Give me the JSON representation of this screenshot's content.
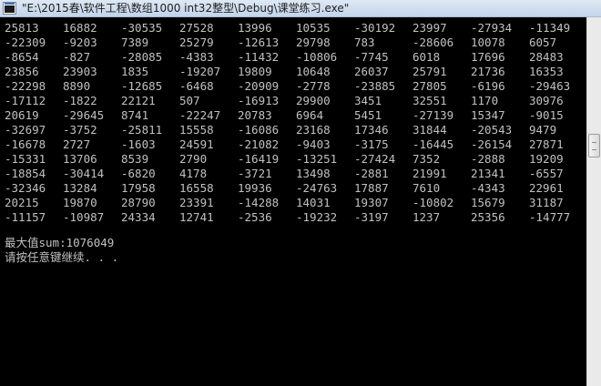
{
  "window": {
    "title": "\"E:\\2015春\\软件工程\\数组1000  int32整型\\Debug\\课堂练习.exe\"",
    "icon": "console-app-icon"
  },
  "console": {
    "rows": [
      [
        "25813",
        "16882",
        "-30535",
        "27528",
        "13996",
        "10535",
        "-30192",
        "23997",
        "-27934",
        "-11349"
      ],
      [
        "-22309",
        "-9203",
        "7389",
        "25279",
        "-12613",
        "29798",
        "783",
        "-28606",
        "10078",
        "6057"
      ],
      [
        "-8654",
        "-827",
        "-28085",
        "-4383",
        "-11432",
        "-10806",
        "-7745",
        "6018",
        "17696",
        "28483"
      ],
      [
        "23856",
        "23903",
        "1835",
        "-19207",
        "19809",
        "10648",
        "26037",
        "25791",
        "21736",
        "16353"
      ],
      [
        "-22298",
        "8890",
        "-12685",
        "-6468",
        "-20909",
        "-2778",
        "-23885",
        "27805",
        "-6196",
        "-29463"
      ],
      [
        "-17112",
        "-1822",
        "22121",
        "507",
        "-16913",
        "29900",
        "3451",
        "32551",
        "1170",
        "30976"
      ],
      [
        "20619",
        "-29645",
        "8741",
        "-22247",
        "20783",
        "6964",
        "5451",
        "-27139",
        "15347",
        "-9015"
      ],
      [
        "-32697",
        "-3752",
        "-25811",
        "15558",
        "-16086",
        "23168",
        "17346",
        "31844",
        "-20543",
        "9479"
      ],
      [
        "-16678",
        "2727",
        "-1603",
        "24591",
        "-21082",
        "-9403",
        "-3175",
        "-16445",
        "-26154",
        "27871"
      ],
      [
        "-15331",
        "13706",
        "8539",
        "2790",
        "-16419",
        "-13251",
        "-27424",
        "7352",
        "-2888",
        "19209"
      ],
      [
        "-18854",
        "-30414",
        "-6820",
        "4178",
        "-3721",
        "13498",
        "-2881",
        "21991",
        "21341",
        "-6557"
      ],
      [
        "-32346",
        "13284",
        "17958",
        "16558",
        "19936",
        "-24763",
        "17887",
        "7610",
        "-4343",
        "22961"
      ],
      [
        "20215",
        "19870",
        "28790",
        "23391",
        "-14288",
        "14031",
        "19307",
        "-10802",
        "15679",
        "31187"
      ],
      [
        "-11157",
        "-10987",
        "24334",
        "12741",
        "-2536",
        "-19232",
        "-3197",
        "1237",
        "25356",
        "-14777"
      ]
    ],
    "result_line": "最大值sum:1076049",
    "prompt_line": "请按任意键继续. . ."
  }
}
